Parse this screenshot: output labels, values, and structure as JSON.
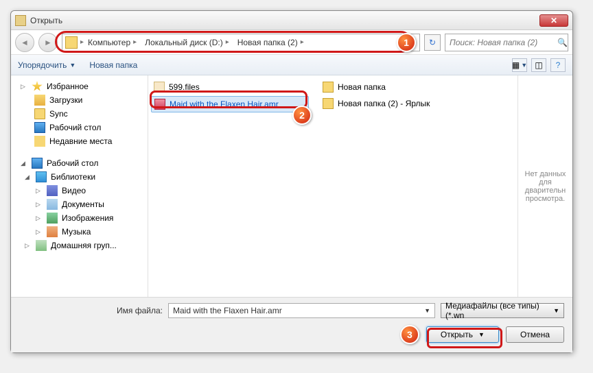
{
  "title": "Открыть",
  "breadcrumbs": [
    "Компьютер",
    "Локальный диск (D:)",
    "Новая папка (2)"
  ],
  "search_placeholder": "Поиск: Новая папка (2)",
  "toolbar": {
    "organize": "Упорядочить",
    "newfolder": "Новая папка"
  },
  "sidebar": {
    "favorites": "Избранное",
    "downloads": "Загрузки",
    "sync": "Sync",
    "desktop": "Рабочий стол",
    "recent": "Недавние места",
    "desktop2": "Рабочий стол",
    "libraries": "Библиотеки",
    "video": "Видео",
    "documents": "Документы",
    "pictures": "Изображения",
    "music": "Музыка",
    "homegroup": "Домашняя груп..."
  },
  "files": {
    "f1": "599.files",
    "f2": "Maid with the Flaxen Hair.amr",
    "f3": "Новая папка",
    "f4": "Новая папка (2) - Ярлык"
  },
  "preview_text": "Нет данных для дварительн просмотра.",
  "footer": {
    "label": "Имя файла:",
    "value": "Maid with the Flaxen Hair.amr",
    "filter": "Медиафайлы (все типы) (*.wn",
    "open": "Открыть",
    "cancel": "Отмена"
  },
  "badges": {
    "b1": "1",
    "b2": "2",
    "b3": "3"
  }
}
